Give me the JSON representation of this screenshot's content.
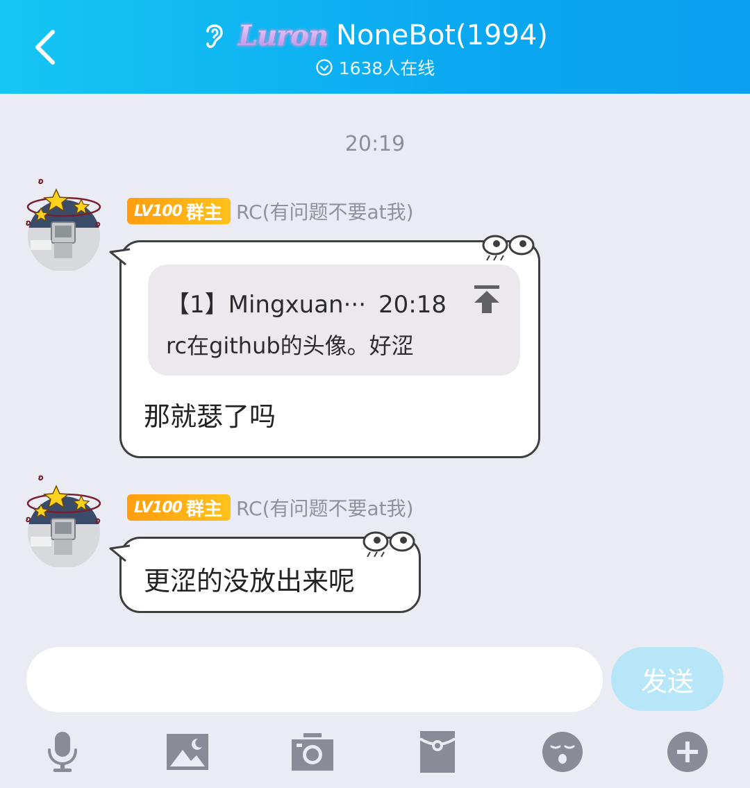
{
  "header": {
    "title": "NoneBot(1994)",
    "badge_text": "Luron",
    "online_text": "1638人在线",
    "gradient_colors": [
      "#16c6f3",
      "#0b9ff0"
    ]
  },
  "chat": {
    "timestamp": "20:19",
    "messages": [
      {
        "level": "LV100",
        "role": "群主",
        "sender": "RC(有问题不要at我)",
        "quote": {
          "header": "【1】Mingxuan···",
          "time": "20:18",
          "text": "rc在github的头像。好涩"
        },
        "text": "那就瑟了吗"
      },
      {
        "level": "LV100",
        "role": "群主",
        "sender": "RC(有问题不要at我)",
        "text": "更涩的没放出来呢"
      }
    ]
  },
  "input": {
    "placeholder": "",
    "value": "",
    "send_label": "发送"
  },
  "toolbar": {
    "icons": [
      "microphone-icon",
      "image-icon",
      "camera-icon",
      "red-packet-icon",
      "emoji-icon",
      "plus-icon"
    ]
  },
  "colors": {
    "accent": "#0aa9f1",
    "send_button": "#b6e6f8",
    "level_badge": "#ffa812",
    "background": "#ebebf3"
  }
}
